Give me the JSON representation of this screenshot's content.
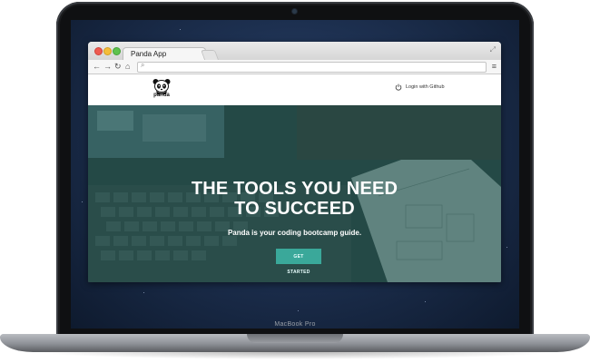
{
  "device": {
    "model_label": "MacBook Pro"
  },
  "browser": {
    "tab_title": "Panda App",
    "address_value": "",
    "nav_icons": [
      "back-icon",
      "forward-icon",
      "reload-icon",
      "home-icon"
    ],
    "menu_icon": "hamburger-icon"
  },
  "site": {
    "logo_text": "panda",
    "login_label": "Login with Github",
    "hero": {
      "title_line1": "THE TOOLS YOU NEED",
      "title_line2": "TO SUCCEED",
      "subtitle": "Panda is your coding bootcamp guide.",
      "cta_label": "GET STARTED"
    }
  },
  "colors": {
    "hero_overlay": "#21534d",
    "cta": "#3aa89a",
    "desktop_bg": "#1d3050"
  }
}
